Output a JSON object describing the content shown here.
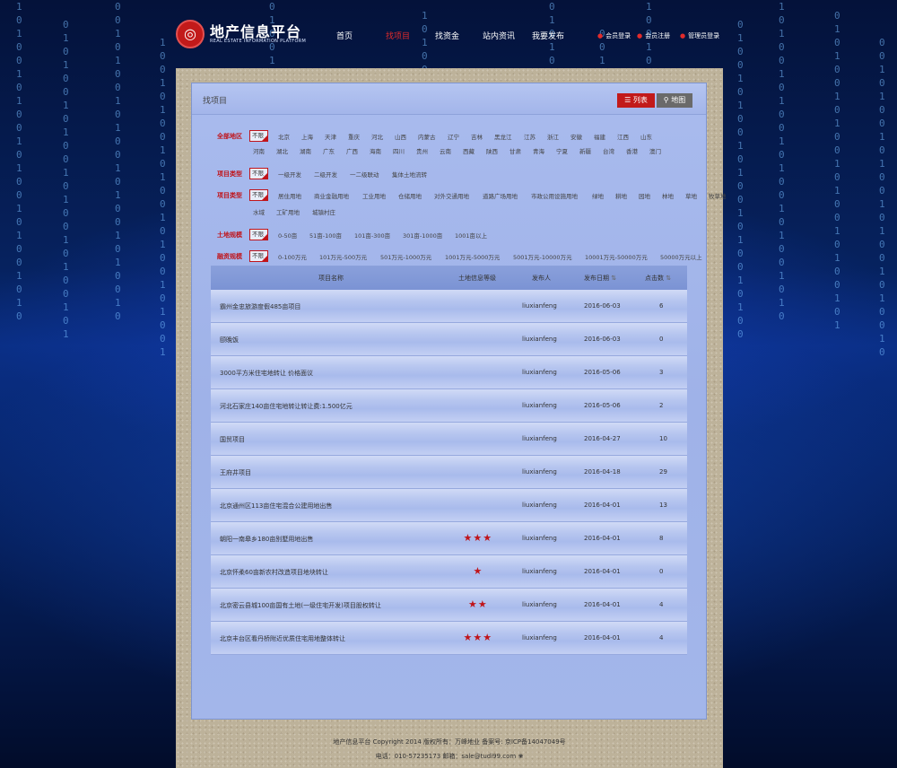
{
  "header": {
    "logo_text": "地产信息平台",
    "logo_sub": "REAL ESTATE INFORMATION PLATFORM",
    "nav": [
      "首页",
      "找项目",
      "找资金",
      "站内资讯",
      "我要发布"
    ],
    "active_nav": "找项目",
    "user_links": [
      "会员登录",
      "会员注册",
      "管理员登录"
    ]
  },
  "panel": {
    "title": "找项目",
    "view_list": "列表",
    "view_map": "地图"
  },
  "filters": [
    {
      "label": "全部地区",
      "all": "不限",
      "options": [
        "北京",
        "上海",
        "天津",
        "重庆",
        "河北",
        "山西",
        "内蒙古",
        "辽宁",
        "吉林",
        "黑龙江",
        "江苏",
        "浙江",
        "安徽",
        "福建",
        "江西",
        "山东",
        "河南",
        "湖北",
        "湖南",
        "广东",
        "广西",
        "海南",
        "四川",
        "贵州",
        "云南",
        "西藏",
        "陕西",
        "甘肃",
        "青海",
        "宁夏",
        "新疆",
        "台湾",
        "香港",
        "澳门"
      ]
    },
    {
      "label": "项目类型",
      "all": "不限",
      "options": [
        "一级开发",
        "二级开发",
        "一二级联动",
        "集体土地流转"
      ]
    },
    {
      "label": "项目类型",
      "all": "不限",
      "options": [
        "居住用地",
        "商业金融用地",
        "工业用地",
        "仓储用地",
        "对外交通用地",
        "道路广场用地",
        "市政公用设施用地",
        "绿地",
        "耕地",
        "园地",
        "林地",
        "草地",
        "牧草地",
        "水域",
        "工矿用地",
        "城镇村庄"
      ]
    },
    {
      "label": "土地规模",
      "all": "不限",
      "options": [
        "0-50亩",
        "51亩-100亩",
        "101亩-300亩",
        "301亩-1000亩",
        "1001亩以上"
      ]
    },
    {
      "label": "融资规模",
      "all": "不限",
      "options": [
        "0-100万元",
        "101万元-500万元",
        "501万元-1000万元",
        "1001万元-5000万元",
        "5001万元-10000万元",
        "10001万元-50000万元",
        "50000万元以上"
      ]
    }
  ],
  "table": {
    "headers": [
      "项目名称",
      "土地信息等级",
      "发布人",
      "发布日期",
      "点击数"
    ],
    "sort_icon": "⇅",
    "rows": [
      {
        "name": "霸州金忠旅游度假485亩项目",
        "stars": 0,
        "publisher": "liuxianfeng",
        "date": "2016-06-03",
        "clicks": "6"
      },
      {
        "name": "颐晚饭",
        "stars": 0,
        "publisher": "liuxianfeng",
        "date": "2016-06-03",
        "clicks": "0"
      },
      {
        "name": "3000平方米住宅地转让 价格面议",
        "stars": 0,
        "publisher": "liuxianfeng",
        "date": "2016-05-06",
        "clicks": "3"
      },
      {
        "name": "河北石家庄140亩住宅地转让转让费:1.500亿元",
        "stars": 0,
        "publisher": "liuxianfeng",
        "date": "2016-05-06",
        "clicks": "2"
      },
      {
        "name": "国贸项目",
        "stars": 0,
        "publisher": "liuxianfeng",
        "date": "2016-04-27",
        "clicks": "10"
      },
      {
        "name": "王府井项目",
        "stars": 0,
        "publisher": "liuxianfeng",
        "date": "2016-04-18",
        "clicks": "29"
      },
      {
        "name": "北京通州区113亩住宅混合公建用地出售",
        "stars": 0,
        "publisher": "liuxianfeng",
        "date": "2016-04-01",
        "clicks": "13"
      },
      {
        "name": "朝阳一南皋乡180亩别墅用地出售",
        "stars": 3,
        "publisher": "liuxianfeng",
        "date": "2016-04-01",
        "clicks": "8"
      },
      {
        "name": "北京怀柔60亩新农村改造项目地块转让",
        "stars": 1,
        "publisher": "liuxianfeng",
        "date": "2016-04-01",
        "clicks": "0"
      },
      {
        "name": "北京密云县城100亩国有土地(一级住宅开发)项目股权转让",
        "stars": 2,
        "publisher": "liuxianfeng",
        "date": "2016-04-01",
        "clicks": "4"
      },
      {
        "name": "北京丰台区看丹桥附近优质住宅用地整体转让",
        "stars": 3,
        "publisher": "liuxianfeng",
        "date": "2016-04-01",
        "clicks": "4"
      }
    ]
  },
  "footer": {
    "line1": "地产信息平台 Copyright 2014 版权所有：万峰地业 备案号: 京ICP备14047049号",
    "line2": "电话：010-57235173 邮箱：sale@tudi99.com"
  },
  "colors": {
    "accent": "#c0141a",
    "panel": "#a9bbee",
    "background": "#031a4e"
  }
}
